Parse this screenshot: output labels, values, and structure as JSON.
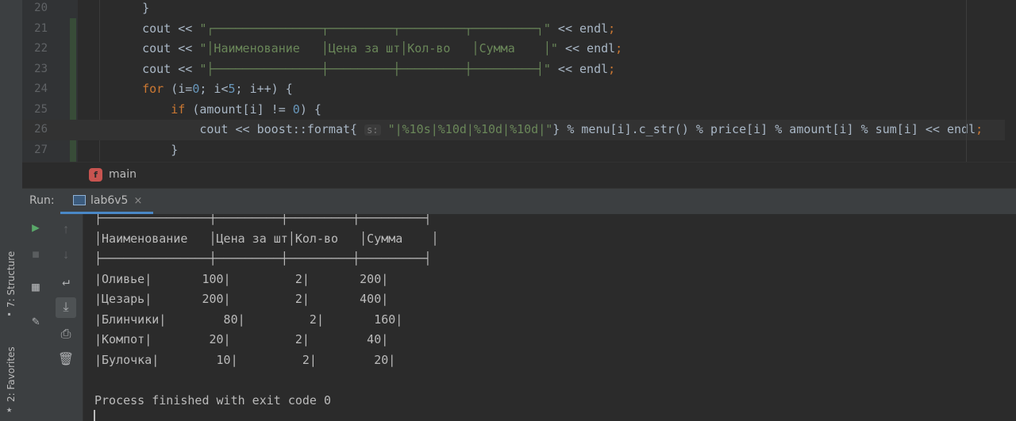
{
  "editor": {
    "lines": [
      {
        "n": "20",
        "code": [
          {
            "t": "    }",
            "c": ""
          }
        ]
      },
      {
        "n": "21",
        "code": [
          {
            "t": "    cout << ",
            "c": ""
          },
          {
            "t": "\"┌───────────────┬─────────┬─────────┬─────────┐\"",
            "c": "str"
          },
          {
            "t": " << endl",
            "c": ""
          },
          {
            "t": ";",
            "c": "kw"
          }
        ]
      },
      {
        "n": "22",
        "code": [
          {
            "t": "    cout << ",
            "c": ""
          },
          {
            "t": "\"│Наименование   │Цена за шт│Кол-во   │Сумма    │\"",
            "c": "str"
          },
          {
            "t": " << endl",
            "c": ""
          },
          {
            "t": ";",
            "c": "kw"
          }
        ]
      },
      {
        "n": "23",
        "code": [
          {
            "t": "    cout << ",
            "c": ""
          },
          {
            "t": "\"├───────────────┼─────────┼─────────┼─────────┤\"",
            "c": "str"
          },
          {
            "t": " << endl",
            "c": ""
          },
          {
            "t": ";",
            "c": "kw"
          }
        ]
      },
      {
        "n": "24",
        "code": [
          {
            "t": "    ",
            "c": ""
          },
          {
            "t": "for",
            "c": "kw"
          },
          {
            "t": " (i=",
            "c": ""
          },
          {
            "t": "0",
            "c": "num"
          },
          {
            "t": "; i<",
            "c": ""
          },
          {
            "t": "5",
            "c": "num"
          },
          {
            "t": "; i++) {",
            "c": ""
          }
        ]
      },
      {
        "n": "25",
        "code": [
          {
            "t": "        ",
            "c": ""
          },
          {
            "t": "if",
            "c": "kw"
          },
          {
            "t": " (amount[i] != ",
            "c": ""
          },
          {
            "t": "0",
            "c": "num"
          },
          {
            "t": ") {",
            "c": ""
          }
        ]
      },
      {
        "n": "26",
        "code": [
          {
            "t": "            cout << boost::format{ ",
            "c": ""
          },
          {
            "t": "s:",
            "c": "hint"
          },
          {
            "t": " ",
            "c": ""
          },
          {
            "t": "\"|%10s|%10d|%10d|%10d|\"",
            "c": "str"
          },
          {
            "t": "} % menu[i].c_str() % price[i] % amount[i] % sum[i] << endl",
            "c": ""
          },
          {
            "t": ";",
            "c": "kw"
          }
        ]
      },
      {
        "n": "27",
        "code": [
          {
            "t": "        }",
            "c": ""
          }
        ]
      }
    ],
    "current_line_index": 6
  },
  "breadcrumb": {
    "icon_letter": "f",
    "label": "main"
  },
  "run": {
    "title": "Run:",
    "tab_label": "lab6v5",
    "tab_close": "×"
  },
  "left_strip": {
    "structure_label": "7: Structure",
    "favorites_label": "2: Favorites"
  },
  "toolbar_icons": {
    "rerun": "play-icon",
    "stop": "stop-icon",
    "layout": "layout-icon",
    "pin": "pin-icon",
    "up": "arrow-up-icon",
    "down": "arrow-down-icon",
    "wrap": "soft-wrap-icon",
    "scroll_end": "scroll-to-end-icon",
    "print": "print-icon",
    "trash": "trash-icon"
  },
  "console": {
    "lines": [
      "├───────────────┼─────────┼─────────┼─────────┤",
      "│Наименование   │Цена за шт│Кол-во   │Сумма    │",
      "├───────────────┼─────────┼─────────┼─────────┤",
      "|Оливье|       100|         2|       200|",
      "|Цезарь|       200|         2|       400|",
      "|Блинчики|        80|         2|       160|",
      "|Компот|        20|         2|        40|",
      "|Булочка|        10|         2|        20|",
      "",
      "Process finished with exit code 0"
    ]
  },
  "colors": {
    "accent": "#4a88c7",
    "run_green": "#59a869",
    "keyword": "#cc7832",
    "string": "#6a8759",
    "number": "#6897bb"
  }
}
